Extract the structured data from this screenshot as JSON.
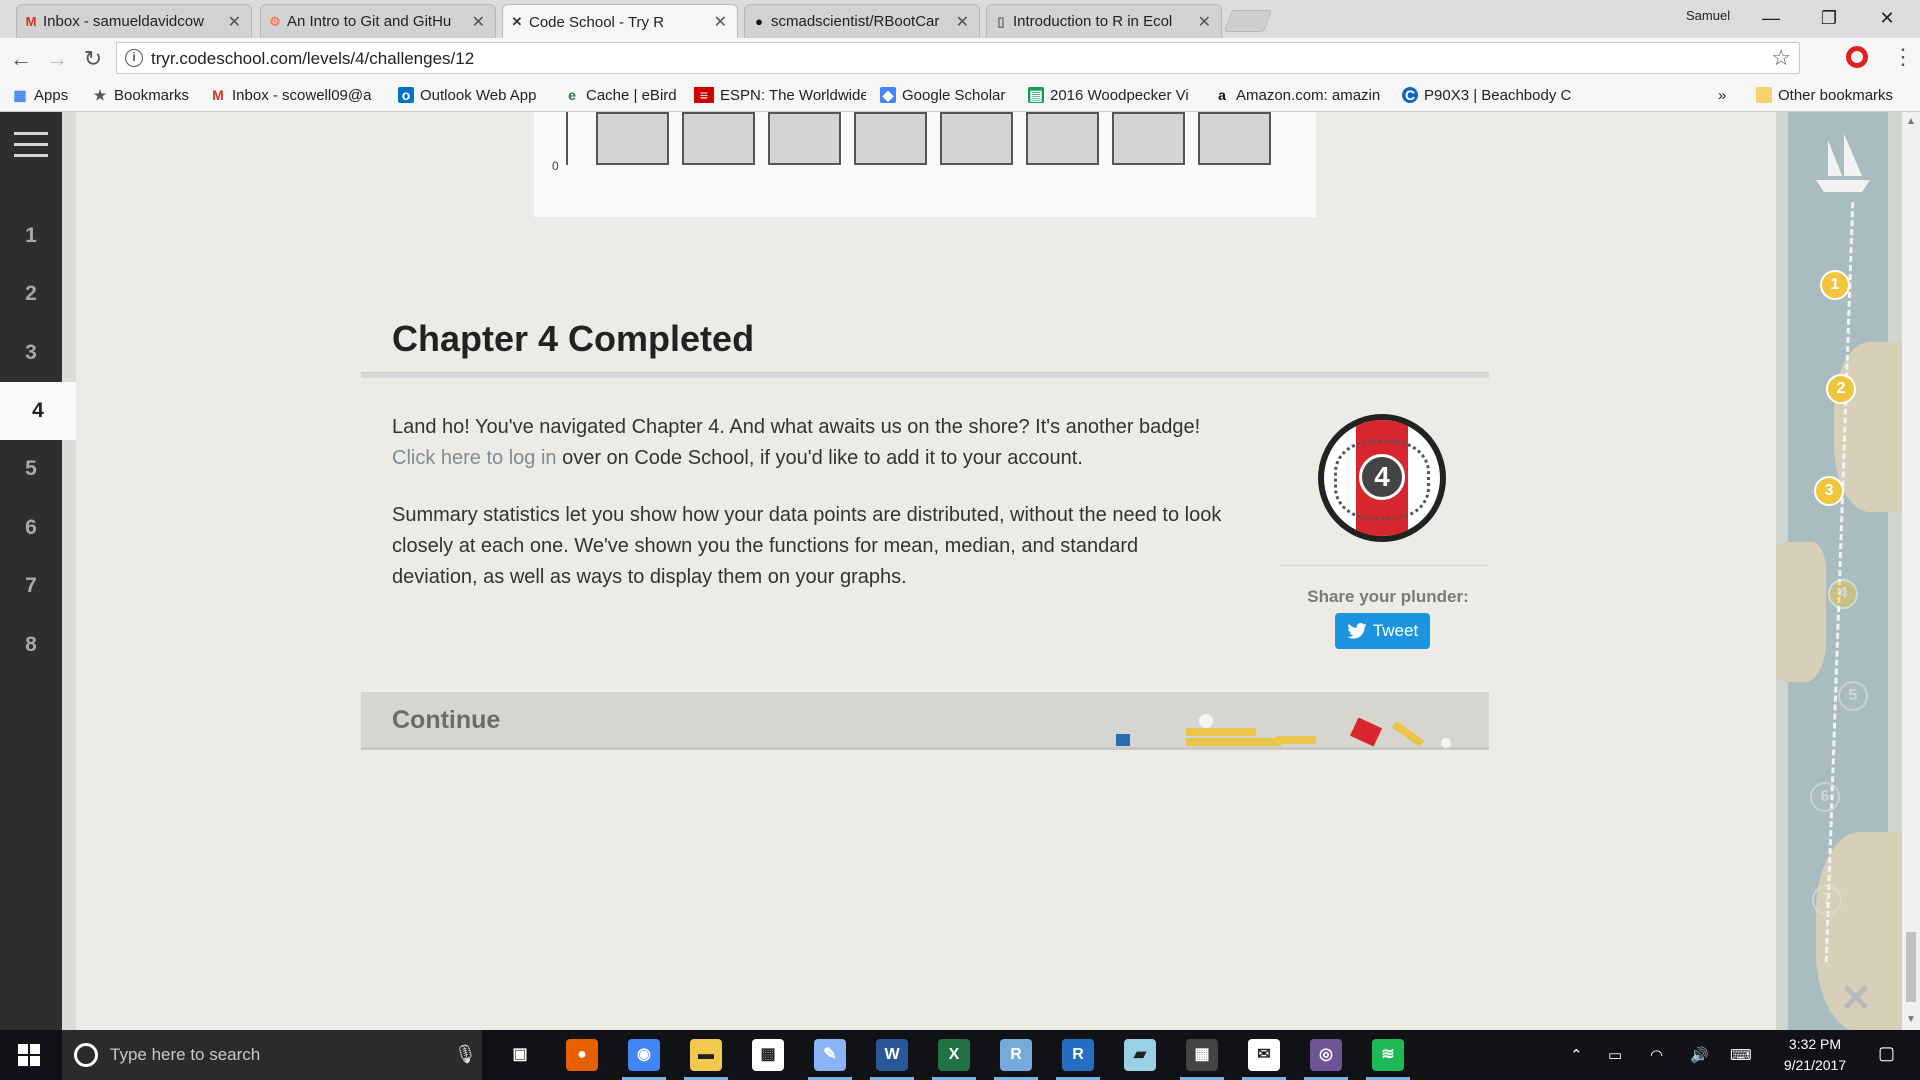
{
  "browser": {
    "tabs": [
      {
        "label": "Inbox - samueldavidcow",
        "favicon": "gmail-icon",
        "active": false
      },
      {
        "label": "An Intro to Git and GitHu",
        "favicon": "hubspot-icon",
        "active": false
      },
      {
        "label": "Code School - Try R",
        "favicon": "codeschool-icon",
        "active": true
      },
      {
        "label": "scmadscientist/RBootCar",
        "favicon": "github-icon",
        "active": false
      },
      {
        "label": "Introduction to R in Ecol",
        "favicon": "document-icon",
        "active": false
      }
    ],
    "user": "Samuel",
    "url": "tryr.codeschool.com/levels/4/challenges/12",
    "bookmarks": [
      {
        "label": "Apps",
        "icon": "apps-grid-icon",
        "color": "#4285f4"
      },
      {
        "label": "Bookmarks",
        "icon": "star-icon",
        "color": "#555555"
      },
      {
        "label": "Inbox - scowell09@a",
        "icon": "gmail-icon",
        "color": "#d93025"
      },
      {
        "label": "Outlook Web App",
        "icon": "outlook-icon",
        "color": "#0072c6"
      },
      {
        "label": "Cache | eBird",
        "icon": "ebird-icon",
        "color": "#2e7d32"
      },
      {
        "label": "ESPN: The Worldwide",
        "icon": "espn-icon",
        "color": "#cc0000"
      },
      {
        "label": "Google Scholar",
        "icon": "scholar-icon",
        "color": "#4285f4"
      },
      {
        "label": "2016 Woodpecker Vi",
        "icon": "sheets-icon",
        "color": "#0f9d58"
      },
      {
        "label": "Amazon.com: amazin",
        "icon": "amazon-icon",
        "color": "#111111"
      },
      {
        "label": "P90X3 | Beachbody C",
        "icon": "beachbody-icon",
        "color": "#1565c0"
      }
    ],
    "overflow": "»",
    "other_bookmarks": "Other bookmarks"
  },
  "sidebar": {
    "chapters": [
      "1",
      "2",
      "3",
      "4",
      "5",
      "6",
      "7",
      "8"
    ],
    "active_chapter": "4"
  },
  "progress_map": {
    "nodes": [
      {
        "label": "1",
        "state": "done"
      },
      {
        "label": "2",
        "state": "done"
      },
      {
        "label": "3",
        "state": "done"
      },
      {
        "label": "4",
        "state": "current"
      },
      {
        "label": "5",
        "state": "todo"
      },
      {
        "label": "6",
        "state": "todo"
      },
      {
        "label": "7",
        "state": "todo"
      }
    ]
  },
  "plot": {
    "axis_label": "0",
    "bar_count": 8
  },
  "content": {
    "title": "Chapter 4 Completed",
    "para1_prefix": "Land ho! You've navigated Chapter 4. And what awaits us on the shore? It's another badge!",
    "para1_link": "Click here to log in",
    "para1_suffix": " over on Code School, if you'd like to add it to your account.",
    "para2": "Summary statistics let you show how your data points are distributed, without the need to look closely at each one. We've shown you the functions for mean, median, and standard deviation, as well as ways to display them on your graphs.",
    "badge_number": "4",
    "share_label": "Share your plunder:",
    "tweet_label": "Tweet",
    "continue_label": "Continue"
  },
  "taskbar": {
    "search_placeholder": "Type here to search",
    "apps": [
      {
        "name": "task-view-icon",
        "color": "#101215"
      },
      {
        "name": "firefox-icon",
        "color": "#e66000"
      },
      {
        "name": "chrome-icon",
        "color": "#4285f4"
      },
      {
        "name": "file-explorer-icon",
        "color": "#f2c94c"
      },
      {
        "name": "store-icon",
        "color": "#ffffff"
      },
      {
        "name": "paint-icon",
        "color": "#8ab4f8"
      },
      {
        "name": "word-icon",
        "color": "#2b579a"
      },
      {
        "name": "excel-icon",
        "color": "#217346"
      },
      {
        "name": "rstudio-icon",
        "color": "#75aadb"
      },
      {
        "name": "r-icon",
        "color": "#276dc3"
      },
      {
        "name": "notes-icon",
        "color": "#9ad0e6"
      },
      {
        "name": "calculator-icon",
        "color": "#444444"
      },
      {
        "name": "mail-icon",
        "color": "#ffffff"
      },
      {
        "name": "github-desktop-icon",
        "color": "#6e5494"
      },
      {
        "name": "spotify-icon",
        "color": "#1db954"
      }
    ],
    "time": "3:32 PM",
    "date": "9/21/2017"
  }
}
